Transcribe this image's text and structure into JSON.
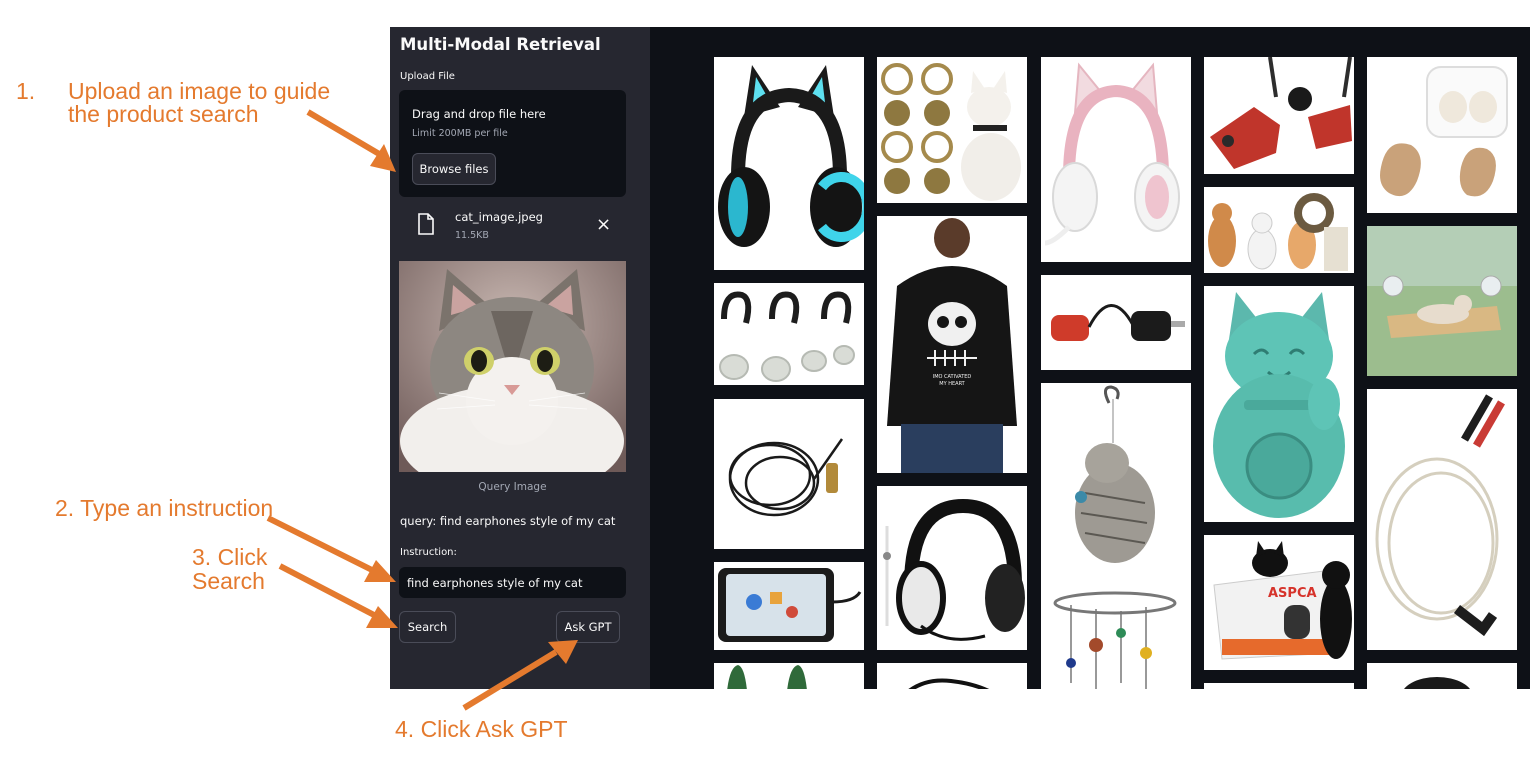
{
  "annotations": {
    "step1_number": "1.",
    "step1_line1": "Upload an image to guide",
    "step1_line2": "the product search",
    "step2": "2. Type an instruction",
    "step3_line1": "3. Click",
    "step3_line2": "Search",
    "step4": "4. Click Ask GPT"
  },
  "sidebar": {
    "title": "Multi-Modal Retrieval",
    "upload_label": "Upload File",
    "dropzone_title": "Drag and drop file here",
    "dropzone_limit": "Limit 200MB per file",
    "browse_label": "Browse files",
    "file_name": "cat_image.jpeg",
    "file_size": "11.5KB",
    "close_icon": "×",
    "image_caption": "Query Image",
    "query_text": "query: find earphones style of my cat",
    "instruction_label": "Instruction:",
    "instruction_value": "find earphones style of my cat",
    "search_label": "Search",
    "ask_gpt_label": "Ask GPT"
  },
  "results": {
    "hoodie_print_line1": "IMO CATIVATED",
    "hoodie_print_line2": "MY HEART",
    "bus_brand": "ASPCA",
    "items": [
      {
        "name": "cat-ear-headphones-black",
        "icon": "headphones-icon"
      },
      {
        "name": "ear-hooks",
        "icon": "ear-hook-icon"
      },
      {
        "name": "audio-cable",
        "icon": "cable-icon"
      },
      {
        "name": "phone-endoscope",
        "icon": "phone-icon"
      },
      {
        "name": "green-clips",
        "icon": "clip-icon"
      },
      {
        "name": "cat-bells",
        "icon": "bell-icon"
      },
      {
        "name": "cat-hoodie",
        "icon": "hoodie-icon"
      },
      {
        "name": "black-headset",
        "icon": "headphones-icon"
      },
      {
        "name": "pink-cat-headphones",
        "icon": "headphones-icon"
      },
      {
        "name": "audio-adapter",
        "icon": "adapter-icon"
      },
      {
        "name": "cat-wind-chime",
        "icon": "chime-icon"
      },
      {
        "name": "red-earphones",
        "icon": "earphone-icon"
      },
      {
        "name": "cats-and-dog",
        "icon": "pet-icon"
      },
      {
        "name": "lucky-cat-statue",
        "icon": "statue-icon"
      },
      {
        "name": "cat-bus-house",
        "icon": "house-icon"
      },
      {
        "name": "hearing-aid",
        "icon": "hearing-aid-icon"
      },
      {
        "name": "window-cat-perch",
        "icon": "perch-icon"
      },
      {
        "name": "electrode-wire",
        "icon": "wire-icon"
      }
    ]
  },
  "colors": {
    "annotation": "#e47a2e",
    "sidebar_bg": "#262730",
    "main_bg": "#0e1117",
    "teal": "#5ec4b6"
  }
}
